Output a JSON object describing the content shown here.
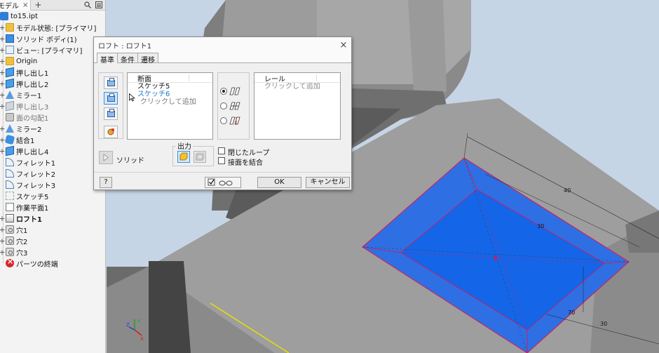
{
  "browser": {
    "tab_label": "モデル",
    "tab_close": "×",
    "add_tab": "+",
    "file": "to15.ipt",
    "items": [
      {
        "label": "モデル状態: [プライマリ]",
        "icon": "folder-icon",
        "expand": "+"
      },
      {
        "label": "ソリッド ボディ(1)",
        "icon": "solid-body-icon",
        "expand": "+"
      },
      {
        "label": "ビュー: [プライマリ]",
        "icon": "view-icon",
        "expand": "+"
      },
      {
        "label": "Origin",
        "icon": "folder-icon",
        "expand": "+"
      },
      {
        "label": "押し出し1",
        "icon": "extrude-icon",
        "expand": "+"
      },
      {
        "label": "押し出し2",
        "icon": "extrude-icon",
        "expand": "+"
      },
      {
        "label": "ミラー1",
        "icon": "mirror-icon",
        "expand": "+"
      },
      {
        "label": "押し出し3",
        "icon": "extrude-icon",
        "expand": "+",
        "dim": true
      },
      {
        "label": "面の勾配1",
        "icon": "face-draft-icon",
        "expand": "",
        "dim": true
      },
      {
        "label": "ミラー2",
        "icon": "mirror-icon",
        "expand": "+"
      },
      {
        "label": "結合1",
        "icon": "combine-icon",
        "expand": "+"
      },
      {
        "label": "押し出し4",
        "icon": "extrude-icon",
        "expand": "+"
      },
      {
        "label": "フィレット1",
        "icon": "fillet-icon",
        "expand": ""
      },
      {
        "label": "フィレット2",
        "icon": "fillet-icon",
        "expand": ""
      },
      {
        "label": "フィレット3",
        "icon": "fillet-icon",
        "expand": ""
      },
      {
        "label": "スケッチ5",
        "icon": "sketch-icon",
        "expand": ""
      },
      {
        "label": "作業平面1",
        "icon": "work-plane-icon",
        "expand": ""
      },
      {
        "label": "ロフト1",
        "icon": "loft-icon",
        "expand": "+",
        "bold": true
      },
      {
        "label": "穴1",
        "icon": "hole-icon",
        "expand": "+"
      },
      {
        "label": "穴2",
        "icon": "hole-icon",
        "expand": "+"
      },
      {
        "label": "穴3",
        "icon": "hole-icon",
        "expand": "+"
      },
      {
        "label": "パーツの終端",
        "icon": "end-of-part-icon",
        "expand": ""
      }
    ]
  },
  "viewport": {
    "dimensions": [
      "40",
      "30",
      "70",
      "30"
    ],
    "colors": {
      "face": "#1565e8",
      "edge": "#e0144e",
      "model": "#8e8e8e",
      "bg": "#c6d5e6"
    }
  },
  "dialog": {
    "title": "ロフト : ロフト1",
    "close": "×",
    "tabs": [
      "基準",
      "条件",
      "遷移"
    ],
    "sections_header": "断面",
    "sections": [
      "スケッチ5",
      "スケッチ6"
    ],
    "sections_hint": "クリックして追加",
    "rails_header": "レール",
    "rails_hint": "クリックして追加",
    "solid_label": "ソリッド",
    "output_label": "出力",
    "closed_loop": "閉じたループ",
    "merge_tangent": "接面を結合",
    "ok": "OK",
    "cancel": "キャンセル",
    "help": "?"
  }
}
